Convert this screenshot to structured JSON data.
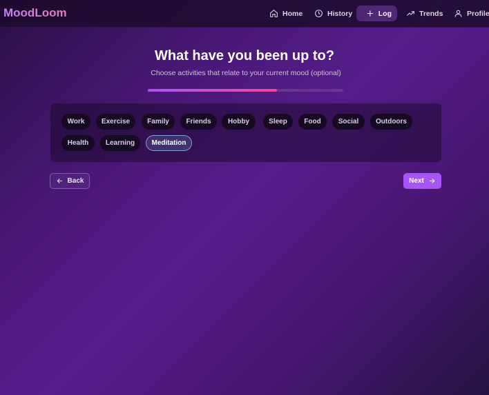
{
  "app": {
    "brand": "MoodLoom"
  },
  "nav": {
    "home": "Home",
    "history": "History",
    "log": "Log",
    "trends": "Trends",
    "profile": "Profile"
  },
  "header": {
    "title": "What have you been up to?",
    "subtitle": "Choose activities that relate to your current mood (optional)",
    "progress": 0.66
  },
  "activities": [
    {
      "label": "Work",
      "selected": false
    },
    {
      "label": "Exercise",
      "selected": false
    },
    {
      "label": "Family",
      "selected": false
    },
    {
      "label": "Friends",
      "selected": false
    },
    {
      "label": "Hobby",
      "selected": false
    },
    {
      "label": "Sleep",
      "selected": false
    },
    {
      "label": "Food",
      "selected": false
    },
    {
      "label": "Social",
      "selected": false
    },
    {
      "label": "Outdoors",
      "selected": false
    },
    {
      "label": "Health",
      "selected": false
    },
    {
      "label": "Learning",
      "selected": false
    },
    {
      "label": "Meditation",
      "selected": true
    }
  ],
  "actions": {
    "back": "Back",
    "next": "Next"
  },
  "colors": {
    "accent": "#a855f7",
    "accent_pink": "#ec4899",
    "chip_bg": "#160a22",
    "chip_selected_border": "#8a9ad8"
  }
}
